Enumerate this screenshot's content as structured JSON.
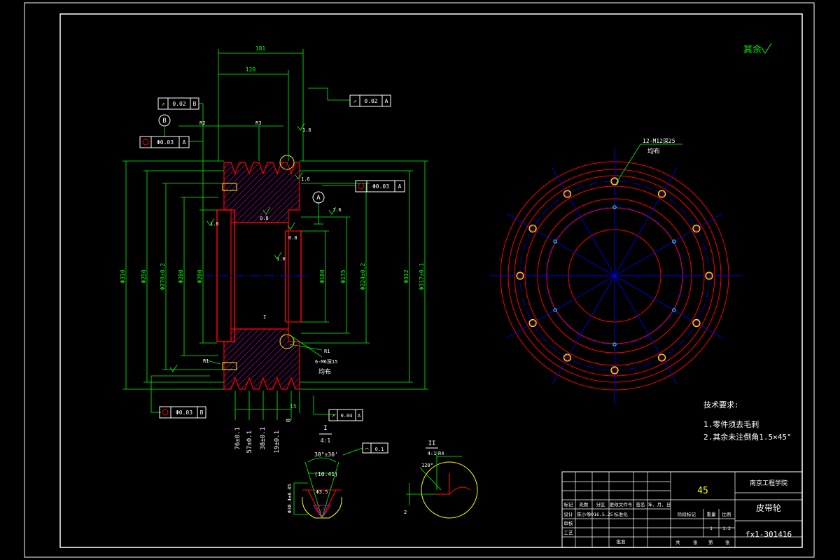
{
  "colors": {
    "background": "#000000",
    "frame": "#ffffff",
    "dimension": "#00ff00",
    "outline": "#ff0000",
    "centerline": "#0000ff",
    "hatch": "#ff00ff",
    "text": "#ffff00"
  },
  "roughness_note": "其余",
  "section_view": {
    "dims_top": [
      "181",
      "120"
    ],
    "tolerance_frames": {
      "runout_top_left": {
        "value": "0.02",
        "datum": "B"
      },
      "runout_top_right": {
        "value": "0.02",
        "datum": "A"
      },
      "coaxial_left": {
        "value": "Φ0.03",
        "datum": "A"
      },
      "coaxial_right": {
        "value": "Φ0.03",
        "datum": "A"
      },
      "coaxial_bottom": {
        "value": "Φ0.03",
        "datum": "B"
      },
      "runout_bottom": {
        "value": "0.04",
        "datum": "A"
      }
    },
    "datum_labels": [
      "B",
      "A"
    ],
    "small_labels": [
      "R2",
      "R3",
      "I",
      "R1",
      "R1",
      "6-M6深15",
      "均布",
      "0.8",
      "0.8",
      "1.6",
      "1.6",
      "1.6",
      "1.6",
      "1.6"
    ],
    "vertical_dims": [
      "Φ310",
      "Φ250",
      "Φ270±0.2",
      "Φ280",
      "Φ200",
      "Φ180",
      "Φ175",
      "Φ224±0.2",
      "Φ312",
      "Φ317±0.1"
    ],
    "bottom_dims": [
      "76±0.1",
      "57±0.1",
      "38±0.1",
      "19±0.1",
      "0",
      "15"
    ]
  },
  "front_view": {
    "hole_note": "12-M12深25",
    "hole_note2": "均布"
  },
  "notes": {
    "title": "技术要求:",
    "items": [
      "1.零件须去毛刺",
      "2.其余未注倒角1.5×45°"
    ]
  },
  "detail_I": {
    "label": "I",
    "scale": "4:1",
    "angle": "38°±30'",
    "dim1": "(10.41)",
    "dim2": "Φ3.5",
    "side_dim": "Φ30.4±0.05",
    "tol": "0.1"
  },
  "detail_II": {
    "label": "II",
    "scale": "4:1",
    "angle": "120°",
    "dim": "R4",
    "side": "2"
  },
  "title_block": {
    "material": "45",
    "school": "南京工程学院",
    "part_name": "皮带轮",
    "drawing_no": "fx1-301416",
    "headers": [
      "标记",
      "处数",
      "分区",
      "更改文件号",
      "签名",
      "年、月、日"
    ],
    "rows": [
      "设计",
      "审核",
      "工艺",
      "批准"
    ],
    "design_name": "陈小冬",
    "design_date": "2016.5.25",
    "std_label": "标准化",
    "stage_label": "阶段标记",
    "weight_label": "重量",
    "scale_label": "比例",
    "scale_value": "1:2",
    "weight_value": "1",
    "sheet_label1": "共",
    "sheet_label2": "张",
    "sheet_label3": "第",
    "sheet_label4": "张"
  }
}
